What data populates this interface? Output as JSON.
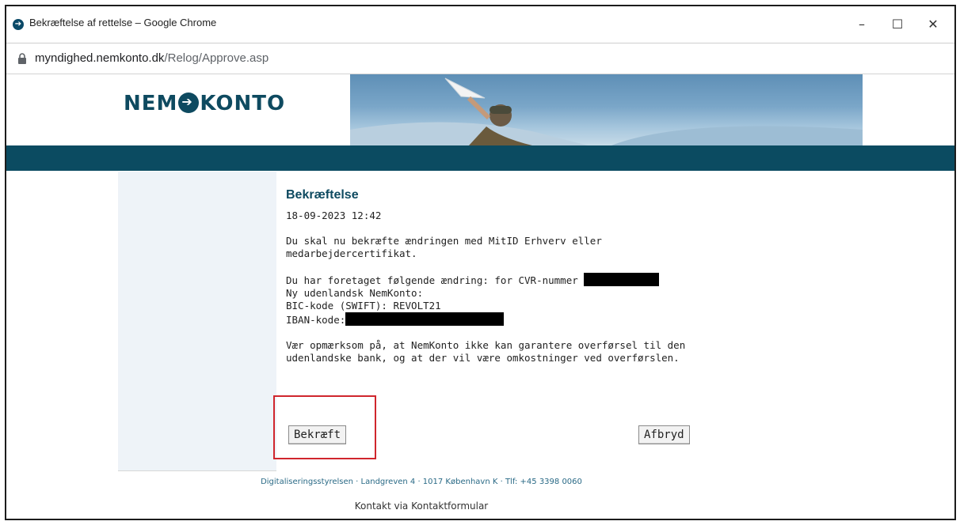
{
  "window": {
    "title": "Bekræftelse af rettelse – Google Chrome",
    "minimize": "–",
    "maximize": "☐",
    "close": "✕"
  },
  "address": {
    "domain": "myndighed.nemkonto.dk",
    "path": "/Relog/Approve.asp"
  },
  "logo": {
    "left": "NEM",
    "right": "KONTO"
  },
  "content": {
    "heading": "Bekræftelse",
    "timestamp": "18-09-2023 12:42",
    "intro_line1": "Du skal nu bekræfte ændringen med MitID Erhverv eller",
    "intro_line2": "medarbejdercertifikat.",
    "change_line1": "Du har foretaget følgende ændring: for CVR-nummer",
    "change_line2": "Ny udenlandsk NemKonto:",
    "change_line3": "BIC-kode (SWIFT): REVOLT21",
    "change_line4": "IBAN-kode:",
    "warning_line1": "Vær opmærksom på, at NemKonto ikke kan garantere overførsel til den",
    "warning_line2": "udenlandske bank, og at der vil være omkostninger ved overførslen."
  },
  "buttons": {
    "confirm": "Bekræft",
    "cancel": "Afbryd"
  },
  "footer": {
    "address": "Digitaliseringsstyrelsen · Landgreven 4 · 1017 København K · Tlf: +45 3398 0060",
    "contact": "Kontakt via Kontaktformular"
  },
  "colors": {
    "brand": "#0e4a60",
    "band": "#0b4b61",
    "highlight": "#d0262d"
  }
}
